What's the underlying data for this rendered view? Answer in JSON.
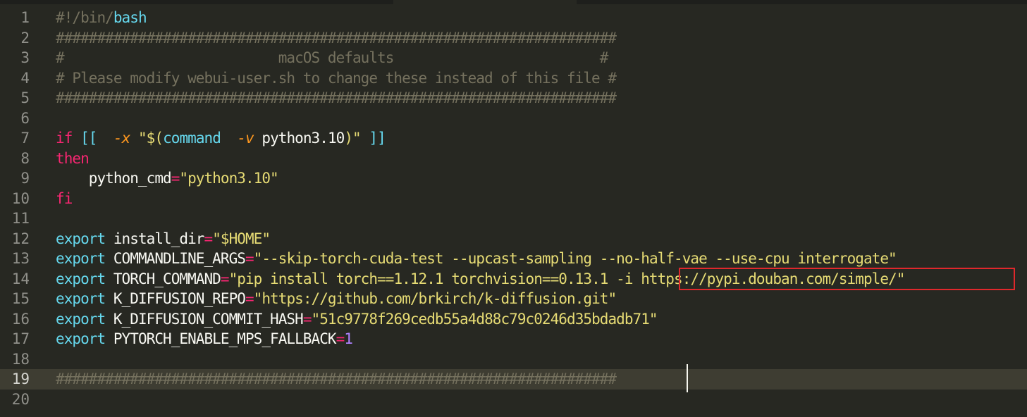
{
  "editor": {
    "lines": [
      {
        "n": "1",
        "tokens": [
          [
            "c-comment",
            "#!/bin/"
          ],
          [
            "c-builtin",
            "bash"
          ]
        ]
      },
      {
        "n": "2",
        "tokens": [
          [
            "c-comment",
            "####################################################################"
          ]
        ]
      },
      {
        "n": "3",
        "tokens": [
          [
            "c-comment",
            "#                          macOS defaults                         #"
          ]
        ]
      },
      {
        "n": "4",
        "tokens": [
          [
            "c-comment",
            "# Please modify webui-user.sh to change these instead of this file #"
          ]
        ]
      },
      {
        "n": "5",
        "tokens": [
          [
            "c-comment",
            "####################################################################"
          ]
        ]
      },
      {
        "n": "6",
        "tokens": []
      },
      {
        "n": "7",
        "tokens": [
          [
            "c-kw",
            "if"
          ],
          [
            "c-plain",
            " "
          ],
          [
            "c-builtin",
            "[["
          ],
          [
            "c-plain",
            "  "
          ],
          [
            "c-flag",
            "-x"
          ],
          [
            "c-plain",
            " "
          ],
          [
            "c-str",
            "\"$("
          ],
          [
            "c-builtin",
            "command"
          ],
          [
            "c-plain",
            "  "
          ],
          [
            "c-flag",
            "-v"
          ],
          [
            "c-plain",
            " python3.10"
          ],
          [
            "c-str",
            ")\""
          ],
          [
            "c-plain",
            " "
          ],
          [
            "c-builtin",
            "]]"
          ]
        ]
      },
      {
        "n": "8",
        "tokens": [
          [
            "c-kw",
            "then"
          ]
        ]
      },
      {
        "n": "9",
        "tokens": [
          [
            "c-plain",
            "    python_cmd"
          ],
          [
            "c-op",
            "="
          ],
          [
            "c-str",
            "\"python3.10\""
          ]
        ]
      },
      {
        "n": "10",
        "tokens": [
          [
            "c-kw",
            "fi"
          ]
        ]
      },
      {
        "n": "11",
        "tokens": []
      },
      {
        "n": "12",
        "tokens": [
          [
            "c-builtin",
            "export"
          ],
          [
            "c-plain",
            " install_dir"
          ],
          [
            "c-op",
            "="
          ],
          [
            "c-str",
            "\"$HOME\""
          ]
        ]
      },
      {
        "n": "13",
        "tokens": [
          [
            "c-builtin",
            "export"
          ],
          [
            "c-plain",
            " COMMANDLINE_ARGS"
          ],
          [
            "c-op",
            "="
          ],
          [
            "c-str",
            "\"--skip-torch-cuda-test --upcast-sampling --no-half-vae --use-cpu interrogate\""
          ]
        ]
      },
      {
        "n": "14",
        "tokens": [
          [
            "c-builtin",
            "export"
          ],
          [
            "c-plain",
            " TORCH_COMMAND"
          ],
          [
            "c-op",
            "="
          ],
          [
            "c-str",
            "\"pip install torch==1.12.1 torchvision==0.13.1 -i https://pypi.douban.com/simple/\""
          ]
        ]
      },
      {
        "n": "15",
        "tokens": [
          [
            "c-builtin",
            "export"
          ],
          [
            "c-plain",
            " K_DIFFUSION_REPO"
          ],
          [
            "c-op",
            "="
          ],
          [
            "c-str",
            "\"https://github.com/brkirch/k-diffusion.git\""
          ]
        ]
      },
      {
        "n": "16",
        "tokens": [
          [
            "c-builtin",
            "export"
          ],
          [
            "c-plain",
            " K_DIFFUSION_COMMIT_HASH"
          ],
          [
            "c-op",
            "="
          ],
          [
            "c-str",
            "\"51c9778f269cedb55a4d88c79c0246d35bdadb71\""
          ]
        ]
      },
      {
        "n": "17",
        "tokens": [
          [
            "c-builtin",
            "export"
          ],
          [
            "c-plain",
            " PYTORCH_ENABLE_MPS_FALLBACK"
          ],
          [
            "c-op",
            "="
          ],
          [
            "c-num",
            "1"
          ]
        ]
      },
      {
        "n": "18",
        "tokens": []
      },
      {
        "n": "19",
        "active": true,
        "tokens": [
          [
            "c-comment",
            "####################################################################"
          ]
        ]
      },
      {
        "n": "20",
        "tokens": []
      }
    ]
  },
  "colors": {
    "background": "#272822",
    "comment": "#75715e",
    "keyword": "#f92672",
    "builtin": "#66d9ef",
    "string": "#e6db74",
    "flag": "#fd971f",
    "number": "#ae81ff",
    "highlight_box": "#e0282c"
  }
}
